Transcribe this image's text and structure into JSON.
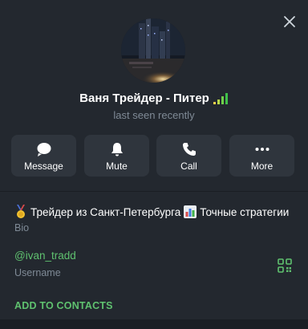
{
  "profile": {
    "name": "Ваня Трейдер - Питер",
    "status": "last seen recently",
    "avatar_icon": "city-night-photo-avatar",
    "name_emoji_icon": "signal-bars-emoji-icon"
  },
  "actions": [
    {
      "label": "Message",
      "icon": "chat-bubble-icon"
    },
    {
      "label": "Mute",
      "icon": "bell-icon"
    },
    {
      "label": "Call",
      "icon": "phone-icon"
    },
    {
      "label": "More",
      "icon": "more-dots-icon"
    }
  ],
  "bio": {
    "text_part1": "Трейдер из Санкт-Петербурга",
    "text_part2": "Точные стратегии",
    "label": "Bio"
  },
  "username": {
    "value": "@ivan_tradd",
    "label": "Username"
  },
  "contacts": {
    "add_label": "ADD TO CONTACTS"
  },
  "colors": {
    "accent": "#5fc16f",
    "background": "#1a1e24",
    "panel": "#23282f",
    "button": "#2f353d",
    "muted_text": "#7f8a96"
  }
}
